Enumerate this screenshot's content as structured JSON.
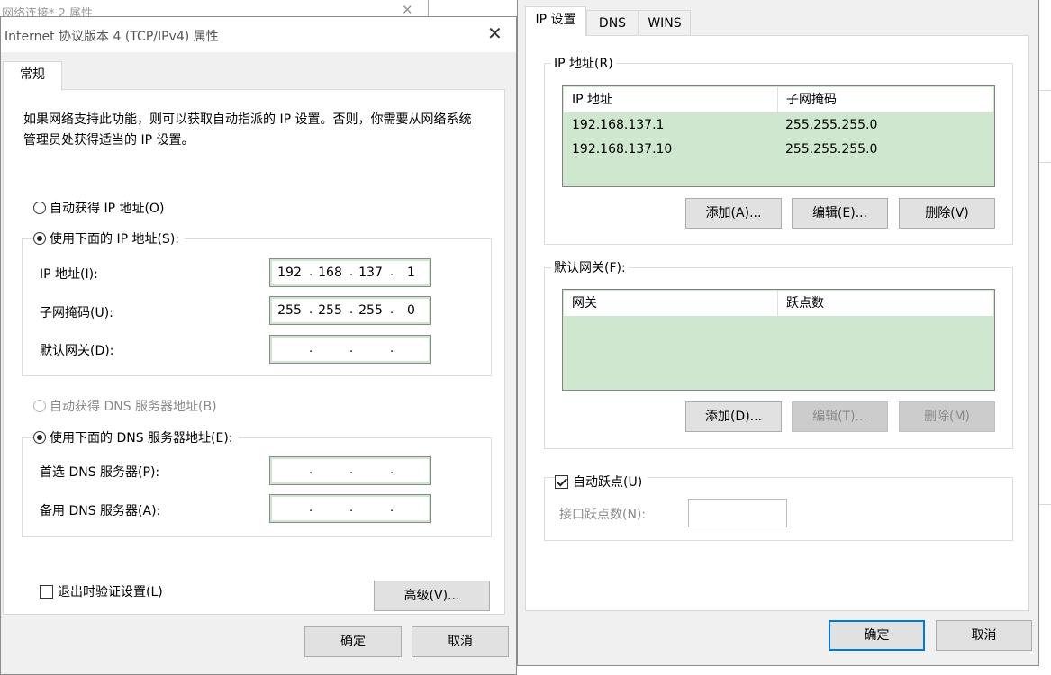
{
  "background": {
    "title": "网络连接* 2 属性",
    "close_glyph": "✕"
  },
  "left_dialog": {
    "title": "Internet 协议版本 4 (TCP/IPv4) 属性",
    "close_glyph": "✕",
    "tab_general": "常规",
    "description": "如果网络支持此功能，则可以获取自动指派的 IP 设置。否则，你需要从网络系统管理员处获得适当的 IP 设置。",
    "radio_auto_ip": "自动获得 IP 地址(O)",
    "radio_manual_ip": "使用下面的 IP 地址(S):",
    "label_ip": "IP 地址(I):",
    "ip_octets": [
      "192",
      "168",
      "137",
      "1"
    ],
    "label_subnet": "子网掩码(U):",
    "subnet_octets": [
      "255",
      "255",
      "255",
      "0"
    ],
    "label_gateway": "默认网关(D):",
    "gateway_octets": [
      "",
      "",
      "",
      ""
    ],
    "radio_auto_dns": "自动获得 DNS 服务器地址(B)",
    "radio_manual_dns": "使用下面的 DNS 服务器地址(E):",
    "label_dns_preferred": "首选 DNS 服务器(P):",
    "dns_preferred_octets": [
      "",
      "",
      "",
      ""
    ],
    "label_dns_alternate": "备用 DNS 服务器(A):",
    "dns_alternate_octets": [
      "",
      "",
      "",
      ""
    ],
    "checkbox_validate": "退出时验证设置(L)",
    "btn_advanced": "高级(V)...",
    "btn_ok": "确定",
    "btn_cancel": "取消",
    "octet_separator": "."
  },
  "right_dialog": {
    "tabs": [
      "IP 设置",
      "DNS",
      "WINS"
    ],
    "ip_group_label": "IP 地址(R)",
    "ip_columns": [
      "IP 地址",
      "子网掩码"
    ],
    "ip_rows": [
      [
        "192.168.137.1",
        "255.255.255.0"
      ],
      [
        "192.168.137.10",
        "255.255.255.0"
      ]
    ],
    "ip_btn_add": "添加(A)...",
    "ip_btn_edit": "编辑(E)...",
    "ip_btn_delete": "删除(V)",
    "gw_group_label": "默认网关(F):",
    "gw_columns": [
      "网关",
      "跃点数"
    ],
    "gw_btn_add": "添加(D)...",
    "gw_btn_edit": "编辑(T)...",
    "gw_btn_delete": "删除(M)",
    "checkbox_auto_metric": "自动跃点(U)",
    "label_interface_metric": "接口跃点数(N):",
    "btn_ok": "确定",
    "btn_cancel": "取消"
  }
}
